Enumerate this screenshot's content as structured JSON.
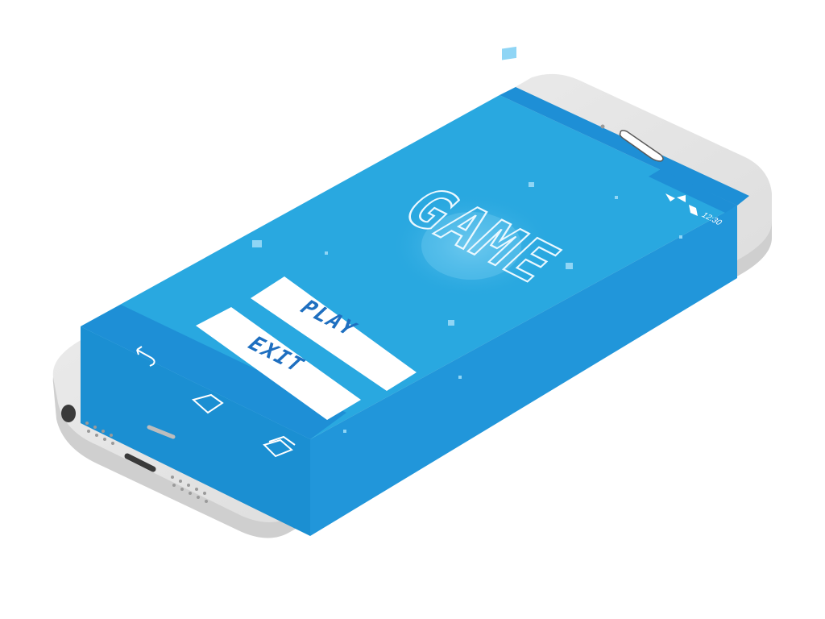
{
  "game": {
    "title": "GAME",
    "play_label": "PLAY",
    "exit_label": "EXIT"
  },
  "status_bar": {
    "time": "12:30",
    "icons": [
      "wifi-icon",
      "signal-icon",
      "battery-icon"
    ]
  },
  "nav_bar": {
    "icons": [
      "back-icon",
      "home-icon",
      "recent-apps-icon"
    ]
  },
  "colors": {
    "screen": "#29a8e0",
    "screen_edge": "#1b8fd2",
    "bars": "#1e8fd6",
    "button_text": "#1e6fc0",
    "phone_body": "#e9e9e9",
    "phone_shadow": "#c9c9c9",
    "title_glow": "#5fc3ec"
  }
}
